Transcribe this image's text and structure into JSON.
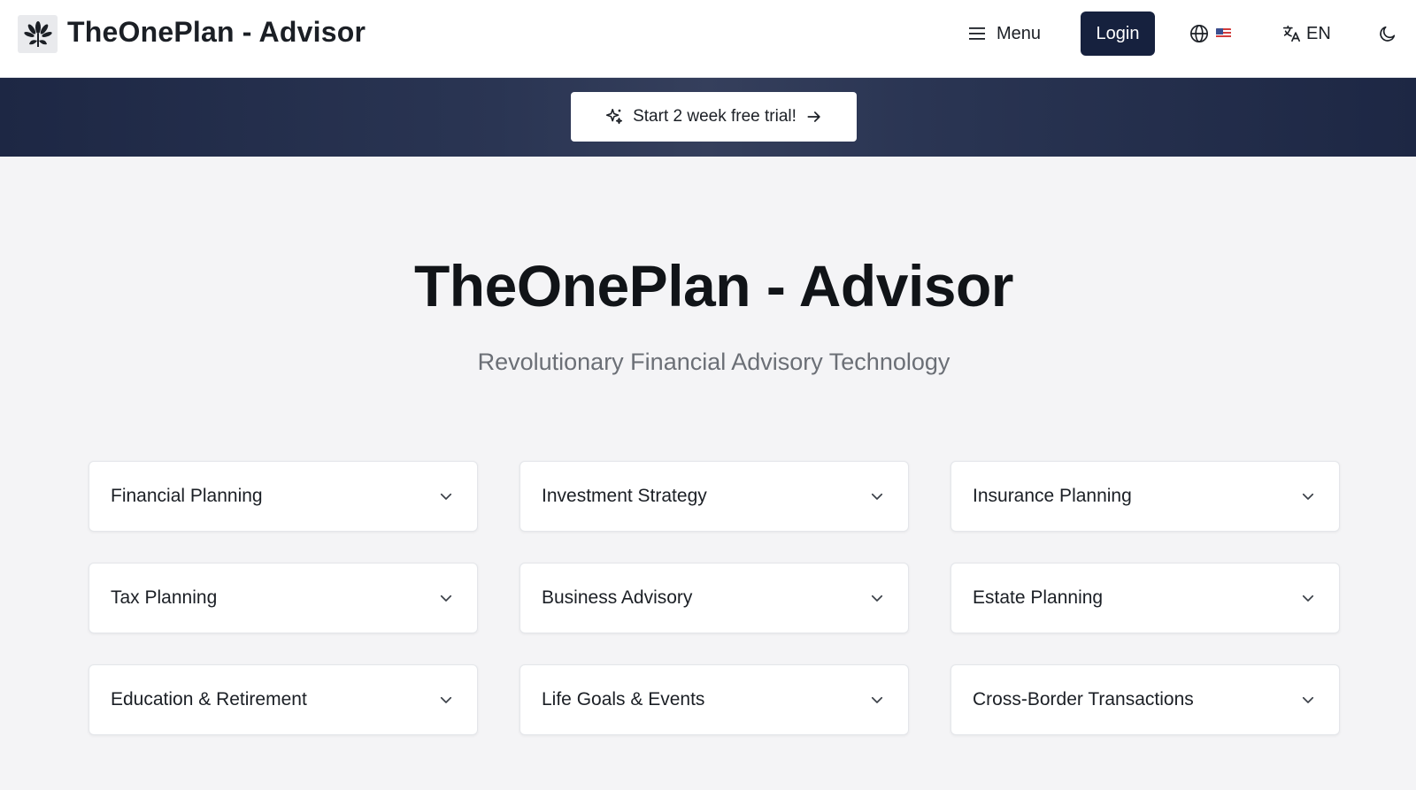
{
  "header": {
    "brand": "TheOnePlan - Advisor",
    "menu_label": "Menu",
    "login_label": "Login",
    "region_flag": "🇺🇸",
    "language_label": "EN",
    "logo_icon": "flower-icon",
    "theme_icon": "moon-icon"
  },
  "banner": {
    "cta_label": "Start 2 week free trial!"
  },
  "hero": {
    "title": "TheOnePlan - Advisor",
    "subtitle": "Revolutionary Financial Advisory Technology"
  },
  "services": [
    {
      "label": "Financial Planning"
    },
    {
      "label": "Investment Strategy"
    },
    {
      "label": "Insurance Planning"
    },
    {
      "label": "Tax Planning"
    },
    {
      "label": "Business Advisory"
    },
    {
      "label": "Estate Planning"
    },
    {
      "label": "Education & Retirement"
    },
    {
      "label": "Life Goals & Events"
    },
    {
      "label": "Cross-Border Transactions"
    }
  ],
  "colors": {
    "primary": "#16213e",
    "banner": "#2a3553",
    "background": "#f4f4f6"
  }
}
